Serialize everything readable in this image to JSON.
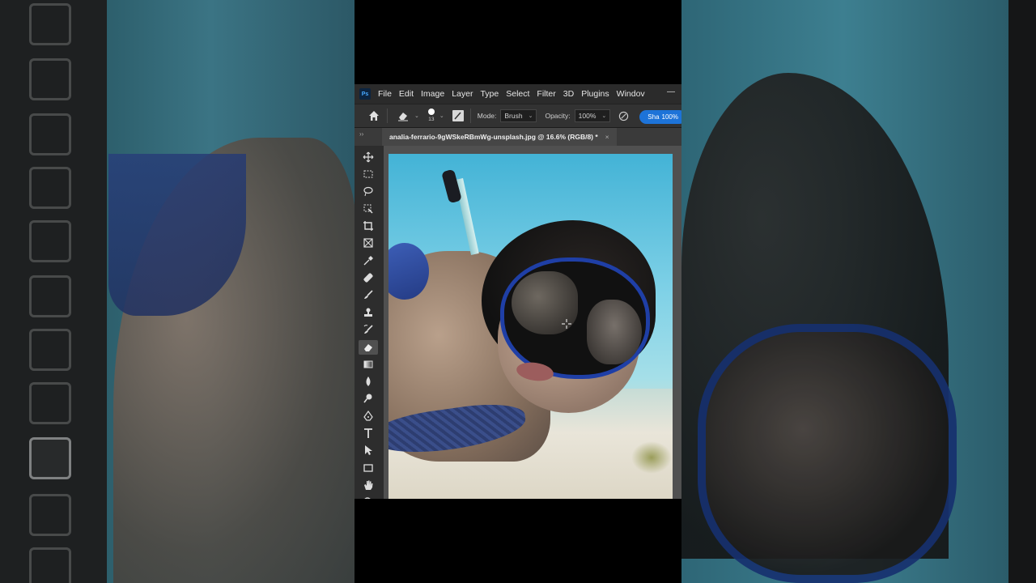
{
  "app": {
    "logo_text": "Ps",
    "menu": [
      "File",
      "Edit",
      "Image",
      "Layer",
      "Type",
      "Select",
      "Filter",
      "3D",
      "Plugins",
      "Windov"
    ],
    "minimize_glyph": "—"
  },
  "options": {
    "brush_size": "13",
    "mode_label": "Mode:",
    "mode_value": "Brush",
    "opacity_label": "Opacity:",
    "opacity_value": "100%",
    "pill_label": "Sha",
    "pill_value": "100%"
  },
  "document": {
    "tab_title": "analia-ferrario-9gWSkeRBmWg-unsplash.jpg @ 16.6% (RGB/8) *",
    "close_glyph": "×",
    "collapse_glyph": "››"
  },
  "toolbar": {
    "tools": [
      "move-icon",
      "marquee-icon",
      "lasso-icon",
      "object-select-icon",
      "crop-icon",
      "frame-icon",
      "eyedropper-icon",
      "healing-brush-icon",
      "brush-icon",
      "clone-stamp-icon",
      "history-brush-icon",
      "eraser-icon",
      "gradient-icon",
      "blur-icon",
      "dodge-icon",
      "pen-icon",
      "type-icon",
      "path-select-icon",
      "rectangle-icon",
      "hand-icon",
      "zoom-icon"
    ],
    "active_tool": "eraser-icon"
  },
  "colors": {
    "accent_blue": "#1d73d8",
    "menubar_bg": "#2b2b2b",
    "toolbar_bg": "#2d2d2d",
    "canvas_bg": "#505050"
  }
}
